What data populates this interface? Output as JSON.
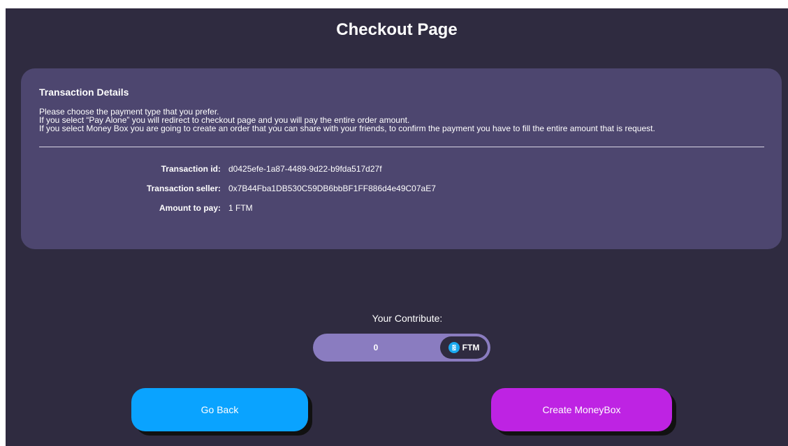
{
  "page": {
    "title": "Checkout Page"
  },
  "card": {
    "heading": "Transaction Details",
    "description": [
      "Please choose the payment type that you prefer.",
      "If you select “Pay Alone” you will redirect to checkout page and you will pay the entire order amount.",
      "If you select Money Box you are going to create an order that you can share with your friends, to confirm the payment you have to fill the entire amount that is request."
    ],
    "details": [
      {
        "label": "Transaction id:",
        "value": "d0425efe-1a87-4489-9d22-b9fda517d27f"
      },
      {
        "label": "Transaction seller:",
        "value": "0x7B44Fba1DB530C59DB6bbBF1FF886d4e49C07aE7"
      },
      {
        "label": "Amount to pay:",
        "value": "1 FTM"
      }
    ]
  },
  "contribute": {
    "label": "Your Contribute:",
    "value": "0",
    "currency": "FTM",
    "currency_icon": "fantom-icon"
  },
  "buttons": {
    "go_back": "Go Back",
    "create_moneybox": "Create MoneyBox"
  },
  "colors": {
    "background": "#2f2b40",
    "card": "#4d466f",
    "contribute_box": "#8a7cc0",
    "go_back": "#0aa3ff",
    "create_moneybox": "#be23e3",
    "ftm_icon": "#1aa9f0"
  }
}
